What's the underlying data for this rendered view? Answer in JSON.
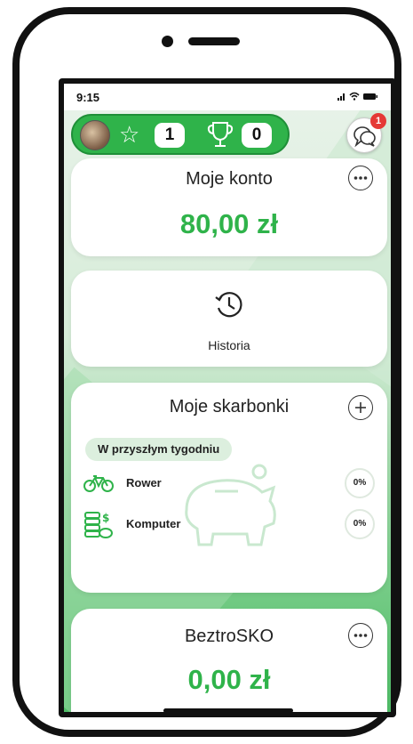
{
  "status_bar": {
    "time": "9:15",
    "icons": "..ıl ≈ ▬"
  },
  "top_bar": {
    "stars_count": "1",
    "trophies_count": "0",
    "chat_badge": "1"
  },
  "account_card": {
    "title": "Moje konto",
    "amount": "80,00 zł"
  },
  "history_card": {
    "label": "Historia"
  },
  "piggy_banks": {
    "title": "Moje skarbonki",
    "section_label": "W przyszłym tygodniu",
    "goals": [
      {
        "name": "Rower",
        "progress": "0%",
        "icon": "bicycle-icon"
      },
      {
        "name": "Komputer",
        "progress": "0%",
        "icon": "coins-icon"
      }
    ]
  },
  "savings_card": {
    "title": "BeztroSKO",
    "amount": "0,00 zł"
  },
  "colors": {
    "accent_green": "#2fb34a",
    "badge_red": "#e53935"
  }
}
